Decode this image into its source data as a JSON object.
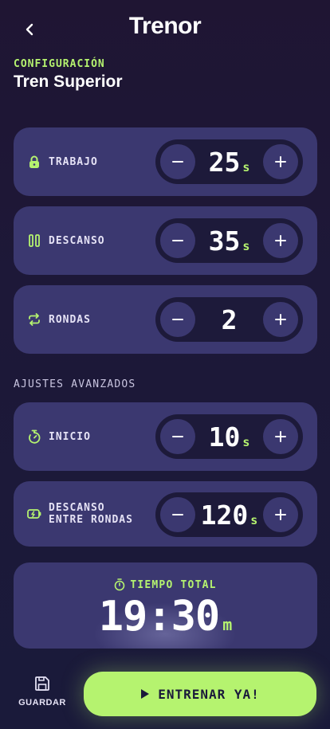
{
  "app": {
    "title": "Trenor"
  },
  "config": {
    "label": "CONFIGURACIÓN",
    "name": "Tren Superior"
  },
  "settings": [
    {
      "label": "TRABAJO",
      "value": "25",
      "unit": "s",
      "icon": "lock-icon"
    },
    {
      "label": "DESCANSO",
      "value": "35",
      "unit": "s",
      "icon": "pause-icon"
    },
    {
      "label": "RONDAS",
      "value": "2",
      "unit": "",
      "icon": "repeat-icon"
    }
  ],
  "advanced": {
    "heading": "AJUSTES AVANZADOS",
    "items": [
      {
        "label": "INICIO",
        "value": "10",
        "unit": "s",
        "icon": "stopwatch-icon"
      },
      {
        "label_line1": "DESCANSO",
        "label_line2": "ENTRE RONDAS",
        "value": "120",
        "unit": "s",
        "icon": "battery-charging-icon"
      }
    ]
  },
  "total": {
    "label": "TIEMPO TOTAL",
    "value": "19:30",
    "unit": "m",
    "icon": "timer-icon"
  },
  "footer": {
    "save_label": "GUARDAR",
    "start_label": "ENTRENAR YA!"
  },
  "colors": {
    "accent": "#b5f36f",
    "card": "#3b3870",
    "background": "#1d1838",
    "stepper": "#1d1a3a"
  }
}
